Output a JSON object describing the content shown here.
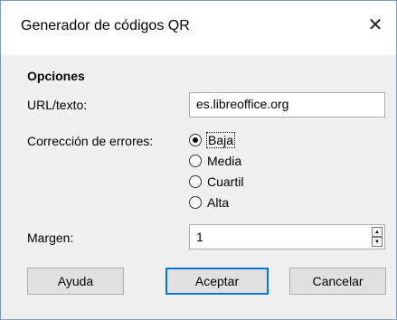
{
  "dialog": {
    "title": "Generador de códigos QR",
    "close_glyph": "✕"
  },
  "options": {
    "section_title": "Opciones",
    "url_label": "URL/texto:",
    "url_value": "es.libreoffice.org",
    "error_label": "Corrección de errores:",
    "error_levels": [
      {
        "label": "Baja",
        "selected": true
      },
      {
        "label": "Media",
        "selected": false
      },
      {
        "label": "Cuartil",
        "selected": false
      },
      {
        "label": "Alta",
        "selected": false
      }
    ],
    "margin_label": "Margen:",
    "margin_value": "1"
  },
  "buttons": {
    "help": "Ayuda",
    "ok": "Aceptar",
    "cancel": "Cancelar"
  },
  "colors": {
    "accent": "#0078d7",
    "dialog_bg": "#f0f0f0",
    "title_bg": "#ffffff"
  }
}
